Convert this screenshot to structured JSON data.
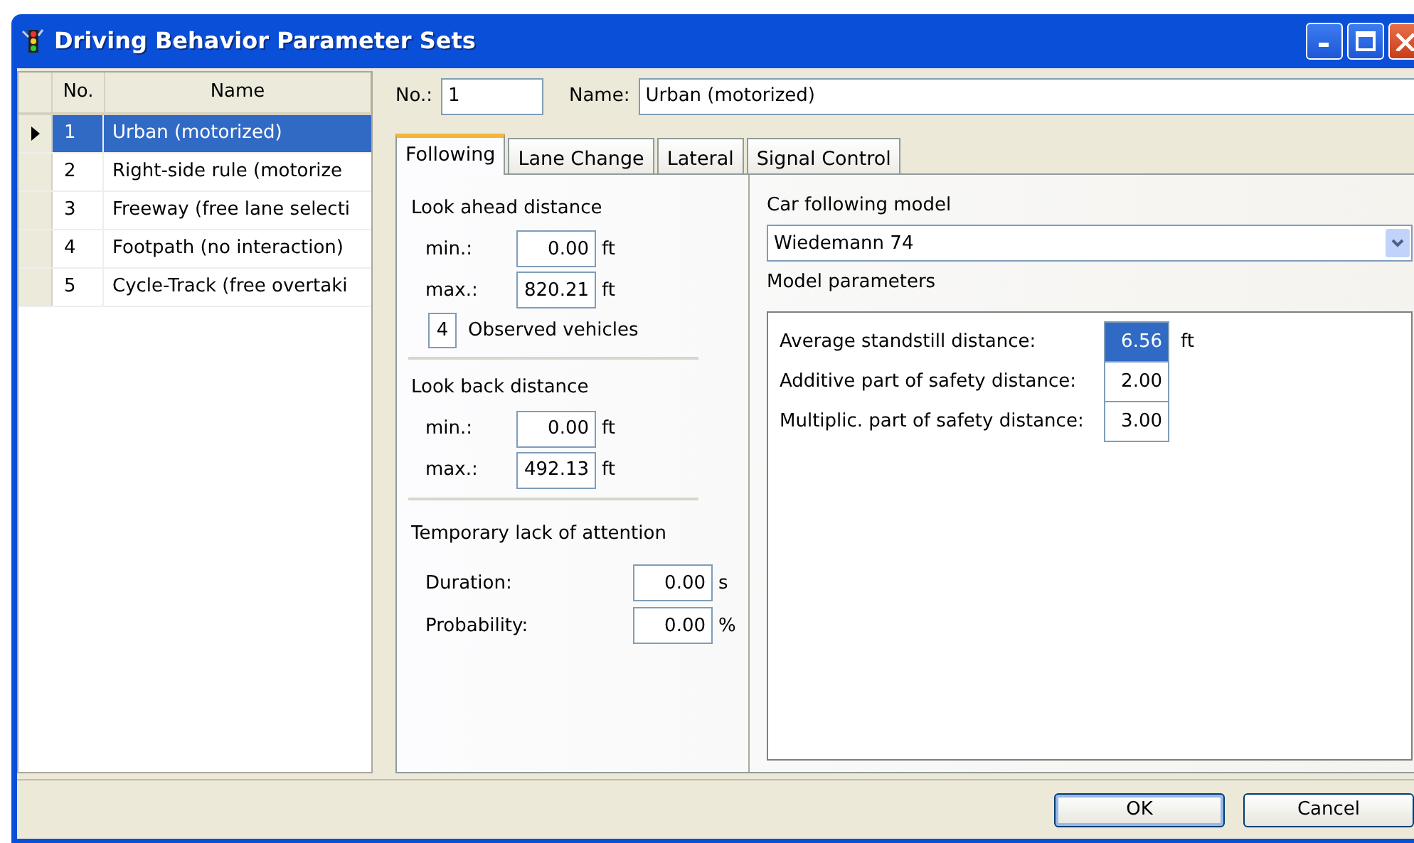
{
  "window": {
    "title": "Driving Behavior Parameter Sets"
  },
  "table": {
    "columns": [
      "No.",
      "Name"
    ],
    "rows": [
      {
        "no": "1",
        "name": "Urban (motorized)",
        "selected": true
      },
      {
        "no": "2",
        "name": "Right-side rule (motorize",
        "selected": false
      },
      {
        "no": "3",
        "name": "Freeway (free lane selecti",
        "selected": false
      },
      {
        "no": "4",
        "name": "Footpath (no interaction)",
        "selected": false
      },
      {
        "no": "5",
        "name": "Cycle-Track (free overtaki",
        "selected": false
      }
    ]
  },
  "header": {
    "no": {
      "label": "No.:",
      "value": "1"
    },
    "name": {
      "label": "Name:",
      "value": "Urban (motorized)"
    }
  },
  "tabs": [
    {
      "label": "Following",
      "selected": true
    },
    {
      "label": "Lane Change",
      "selected": false
    },
    {
      "label": "Lateral",
      "selected": false
    },
    {
      "label": "Signal Control",
      "selected": false
    }
  ],
  "look_ahead": {
    "title": "Look ahead distance",
    "min": {
      "label": "min.:",
      "value": "0.00",
      "unit": "ft"
    },
    "max": {
      "label": "max.:",
      "value": "820.21",
      "unit": "ft"
    },
    "observed": {
      "value": "4",
      "label": "Observed vehicles"
    }
  },
  "look_back": {
    "title": "Look back distance",
    "min": {
      "label": "min.:",
      "value": "0.00",
      "unit": "ft"
    },
    "max": {
      "label": "max.:",
      "value": "492.13",
      "unit": "ft"
    }
  },
  "attention": {
    "title": "Temporary lack of attention",
    "duration": {
      "label": "Duration:",
      "value": "0.00",
      "unit": "s"
    },
    "probability": {
      "label": "Probability:",
      "value": "0.00",
      "unit": "%"
    }
  },
  "car_following": {
    "label": "Car following model",
    "model": "Wiedemann 74",
    "params_label": "Model parameters",
    "params": [
      {
        "label": "Average standstill distance:",
        "value": "6.56",
        "unit": "ft",
        "selected": true
      },
      {
        "label": "Additive part of safety distance:",
        "value": "2.00",
        "selected": false
      },
      {
        "label": "Multiplic. part of safety distance:",
        "value": "3.00",
        "selected": false
      }
    ]
  },
  "buttons": [
    {
      "label": "OK",
      "default": true
    },
    {
      "label": "Cancel",
      "default": false
    }
  ]
}
